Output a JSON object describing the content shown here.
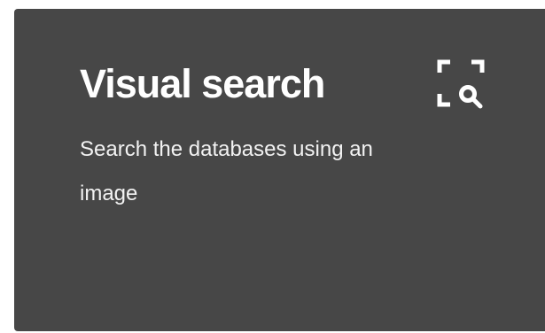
{
  "card": {
    "title": "Visual search",
    "description": "Search the databases using an image",
    "icon": "image-search-icon"
  },
  "colors": {
    "card_background": "#474747",
    "text": "#ffffff"
  }
}
